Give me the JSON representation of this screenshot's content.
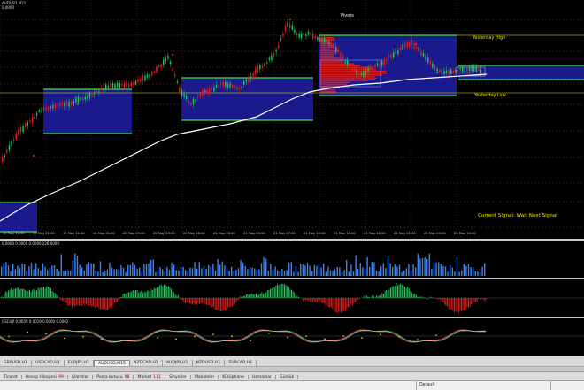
{
  "header": {
    "line1": "AUDUSD,M15",
    "line2": "0.0000"
  },
  "main": {
    "pivots_label": "Pivots",
    "yesterday_high": "Yesterday High",
    "yesterday_low": "Yesterday Low",
    "signal": "Current Signal: Wait Next Signal"
  },
  "time_axis": [
    "19 May 17:00",
    "19 May 21:00",
    "19 May 11:00",
    "19 May 01:00",
    "20 May 09:00",
    "20 May 13:00",
    "20 May 16:00",
    "20 May 23:00",
    "21 May 03:00",
    "21 May 07:00",
    "21 May 10:00",
    "21 May 15:00",
    "21 May 21:00",
    "22 May 01:00",
    "22 May 03:00",
    "22 May 10:00"
  ],
  "subwindows": {
    "volume_label": "0.0000 0.0000 0.0000 226.0000",
    "osc_label": "OSCILP 0.0059 0.0019 0.0000 0.0062"
  },
  "chart_tabs": [
    "GBPUSD,H1",
    "USDCAD,H1",
    "EURJPY,H1",
    "AUDUSD,M15",
    "NZDCAD,H1",
    "AUDJPY,H1",
    "NZDUSD,H1",
    "EURCAD,H1"
  ],
  "active_chart_tab": "AUDUSD,M15",
  "terminal_tabs": [
    {
      "label": "Ticaret",
      "badge": ""
    },
    {
      "label": "Hesap Hikayesi",
      "badge": "99"
    },
    {
      "label": "Alarmlar",
      "badge": ""
    },
    {
      "label": "Posta kutusu",
      "badge": "98"
    },
    {
      "label": "Market",
      "badge": "111"
    },
    {
      "label": "Sinyaller",
      "badge": ""
    },
    {
      "label": "Makaleler",
      "badge": ""
    },
    {
      "label": "Kütüphane",
      "badge": ""
    },
    {
      "label": "Uzmanlar",
      "badge": ""
    },
    {
      "label": "Günlük",
      "badge": ""
    }
  ],
  "status_bar": {
    "profile": "Default"
  },
  "colors": {
    "background": "#000000",
    "box_fill": "#1a1a8c",
    "box_border": "#39e639",
    "ma_line": "#ffffff",
    "candle_green": "#22c55e",
    "candle_red": "#e11d1d",
    "level_line": "#8b1a1a",
    "text_yellow": "#e8e800",
    "volume_blue": "#3b82f6",
    "histo_green": "#22c55e",
    "histo_red": "#e11d1d"
  }
}
